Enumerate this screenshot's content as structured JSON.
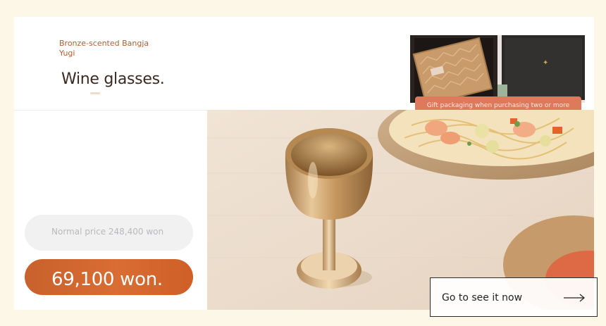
{
  "product": {
    "brand": "Bronze-scented Bangja Yugi",
    "title": "Wine glasses."
  },
  "promo": {
    "gift_badge": "Gift packaging when purchasing two or more"
  },
  "pricing": {
    "normal_price": "Normal price 248,400 won",
    "sale_price": "69,100 won."
  },
  "cta": {
    "label": "Go to see it now",
    "icon": "arrow-right-icon"
  },
  "colors": {
    "page_background": "#fdf7e8",
    "brand_text": "#b0602f",
    "gift_badge": "#dc7a5b",
    "sale_price_pill": "#d96d33",
    "normal_price_pill": "#f1f1f2"
  }
}
